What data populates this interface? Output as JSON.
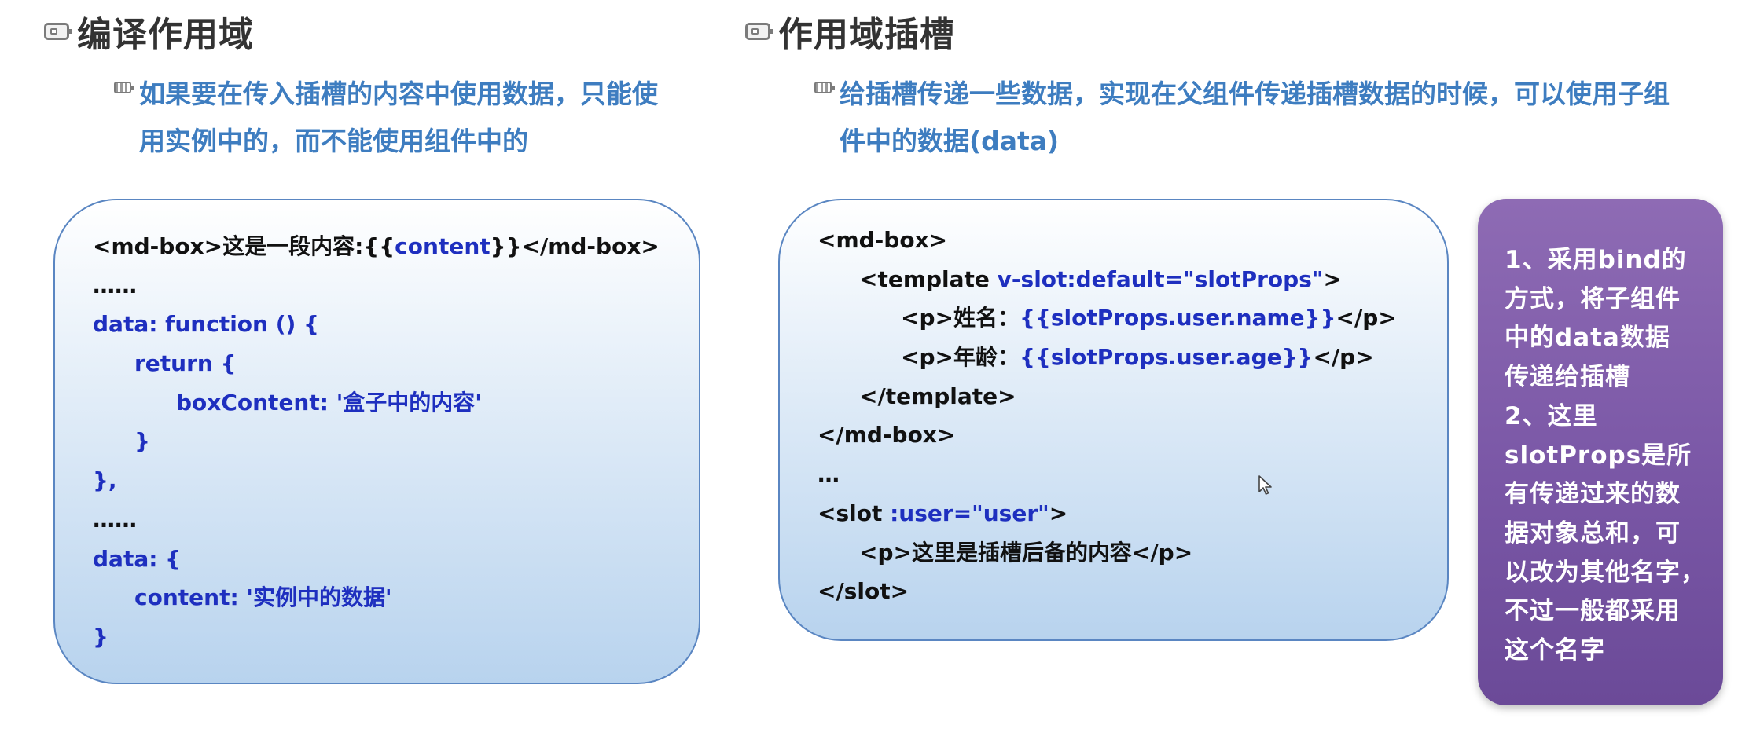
{
  "left": {
    "title": "编译作用域",
    "bullet": "如果要在传入插槽的内容中使用数据，只能使用实例中的，而不能使用组件中的",
    "code": [
      {
        "indent": 0,
        "parts": [
          {
            "t": "<md-box>这是一段内容:{{",
            "c": "k"
          },
          {
            "t": "content",
            "c": "b"
          },
          {
            "t": "}}</md-box>",
            "c": "k"
          }
        ]
      },
      {
        "indent": 0,
        "parts": [
          {
            "t": "……",
            "c": "k"
          }
        ]
      },
      {
        "indent": 0,
        "parts": [
          {
            "t": "data: function () {",
            "c": "b"
          }
        ]
      },
      {
        "indent": 1,
        "parts": [
          {
            "t": "return {",
            "c": "b"
          }
        ]
      },
      {
        "indent": 2,
        "parts": [
          {
            "t": "boxContent: '盒子中的内容'",
            "c": "b"
          }
        ]
      },
      {
        "indent": 1,
        "parts": [
          {
            "t": "}",
            "c": "b"
          }
        ]
      },
      {
        "indent": 0,
        "parts": [
          {
            "t": "},",
            "c": "b"
          }
        ]
      },
      {
        "indent": 0,
        "parts": [
          {
            "t": "……",
            "c": "k"
          }
        ]
      },
      {
        "indent": 0,
        "parts": [
          {
            "t": "data: {",
            "c": "b"
          }
        ]
      },
      {
        "indent": 1,
        "parts": [
          {
            "t": "content: '实例中的数据'",
            "c": "b"
          }
        ]
      },
      {
        "indent": 0,
        "parts": [
          {
            "t": "}",
            "c": "b"
          }
        ]
      }
    ]
  },
  "right": {
    "title": "作用域插槽",
    "bullet": "给插槽传递一些数据，实现在父组件传递插槽数据的时候，可以使用子组件中的数据(data)",
    "code": [
      {
        "indent": 0,
        "parts": [
          {
            "t": "<md-box>",
            "c": "k"
          }
        ]
      },
      {
        "indent": 1,
        "parts": [
          {
            "t": "<template ",
            "c": "k"
          },
          {
            "t": "v-slot:default=\"slotProps\"",
            "c": "b"
          },
          {
            "t": ">",
            "c": "k"
          }
        ]
      },
      {
        "indent": 2,
        "parts": [
          {
            "t": "<p>姓名：",
            "c": "k"
          },
          {
            "t": "{{slotProps.user.name}}",
            "c": "b"
          },
          {
            "t": "</p>",
            "c": "k"
          }
        ]
      },
      {
        "indent": 2,
        "parts": [
          {
            "t": "<p>年龄：",
            "c": "k"
          },
          {
            "t": "{{slotProps.user.age}}",
            "c": "b"
          },
          {
            "t": "</p>",
            "c": "k"
          }
        ]
      },
      {
        "indent": 1,
        "parts": [
          {
            "t": "</template>",
            "c": "k"
          }
        ]
      },
      {
        "indent": 0,
        "parts": [
          {
            "t": "</md-box>",
            "c": "k"
          }
        ]
      },
      {
        "indent": 0,
        "parts": [
          {
            "t": "…",
            "c": "k"
          }
        ]
      },
      {
        "indent": 0,
        "parts": [
          {
            "t": "<slot ",
            "c": "k"
          },
          {
            "t": ":user=\"user\"",
            "c": "b"
          },
          {
            "t": ">",
            "c": "k"
          }
        ]
      },
      {
        "indent": 1,
        "parts": [
          {
            "t": "<p>这里是插槽后备的内容</p>",
            "c": "k"
          }
        ]
      },
      {
        "indent": 0,
        "parts": [
          {
            "t": "</slot>",
            "c": "k"
          }
        ]
      }
    ]
  },
  "note": {
    "lines": [
      "1、采用bind的",
      "方式，将子组件",
      "中的data数据",
      "传递给插槽",
      "2、这里",
      "slotProps是所",
      "有传递过来的数",
      "据对象总和，可",
      "以改为其他名字，",
      "不过一般都采用",
      "这个名字"
    ]
  },
  "colors": {
    "accent_text": "#3e7dc0",
    "code_blue": "#1e2fbf",
    "note_purple": "#7a57a6"
  }
}
